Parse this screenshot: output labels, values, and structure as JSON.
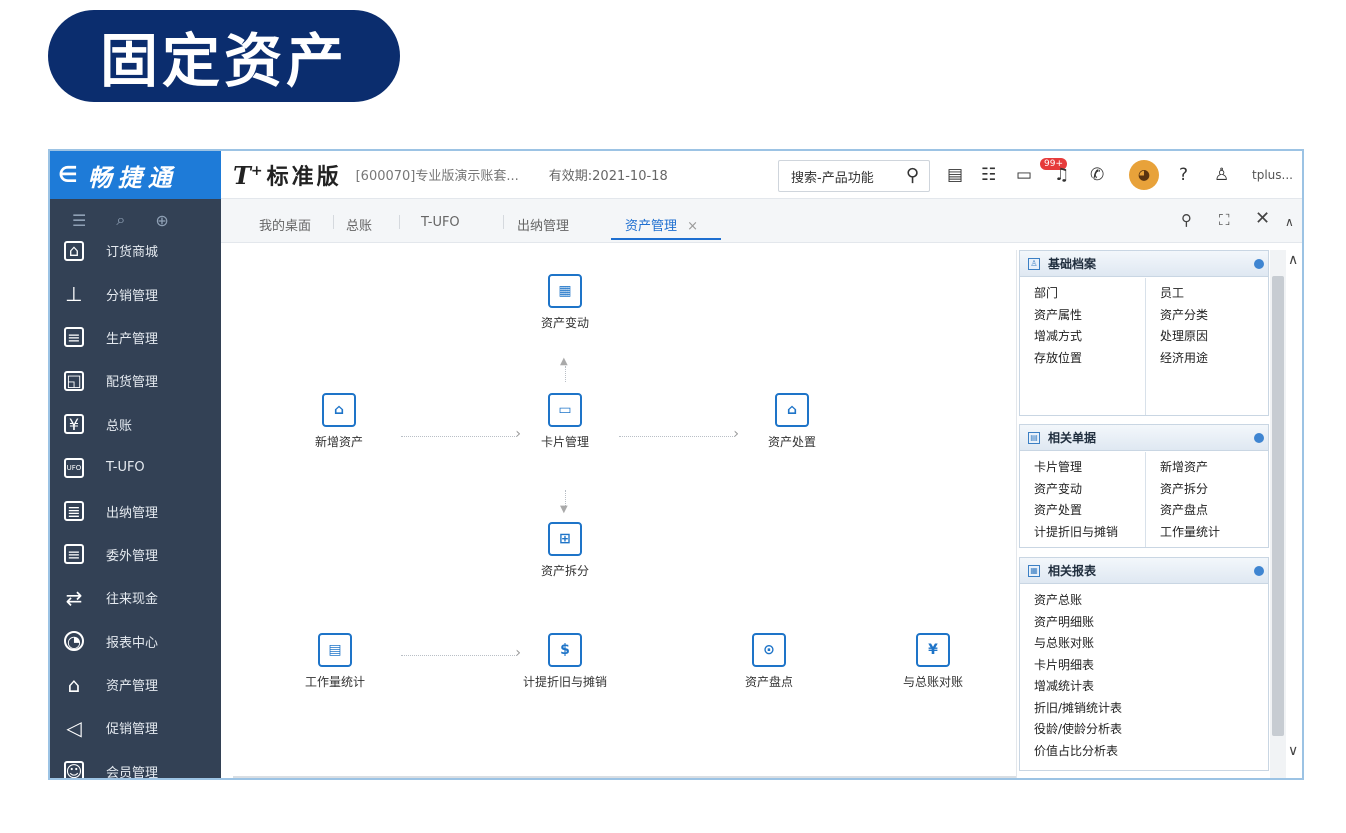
{
  "hero_title": "固定资产",
  "sidebar": {
    "logo": "畅捷通",
    "logo_arrow": "∈",
    "items": [
      {
        "label": "订货商城",
        "icon": "store-icon"
      },
      {
        "label": "分销管理",
        "icon": "org-chart-icon"
      },
      {
        "label": "生产管理",
        "icon": "production-icon"
      },
      {
        "label": "配货管理",
        "icon": "delivery-icon"
      },
      {
        "label": "总账",
        "icon": "ledger-icon"
      },
      {
        "label": "T-UFO",
        "icon": "ufo-icon"
      },
      {
        "label": "出纳管理",
        "icon": "cashier-icon"
      },
      {
        "label": "委外管理",
        "icon": "outsource-icon"
      },
      {
        "label": "往来现金",
        "icon": "exchange-icon"
      },
      {
        "label": "报表中心",
        "icon": "pie-chart-icon"
      },
      {
        "label": "资产管理",
        "icon": "bank-icon"
      },
      {
        "label": "促销管理",
        "icon": "megaphone-icon"
      },
      {
        "label": "会员管理",
        "icon": "member-icon"
      }
    ]
  },
  "topbar": {
    "brand": "T",
    "brand_sup": "+",
    "brand_cn": "标准版",
    "account": "[600070]专业版演示账套...",
    "expiry": "有效期:2021-10-18",
    "search_placeholder": "搜索-产品功能",
    "badge": "99+",
    "username": "tplus..."
  },
  "tabs": [
    "我的桌面",
    "总账",
    "T-UFO",
    "出纳管理",
    "资产管理"
  ],
  "active_tab_close": "×",
  "flow": {
    "asset_change": "资产变动",
    "new_asset": "新增资产",
    "card_management": "卡片管理",
    "asset_disposal": "资产处置",
    "asset_split": "资产拆分",
    "workload_stats": "工作量统计",
    "depreciation": "计提折旧与摊销",
    "asset_inventory": "资产盘点",
    "gl_reconcile": "与总账对账"
  },
  "panels": {
    "basic": {
      "title": "基础档案",
      "col1": [
        "部门",
        "资产属性",
        "增减方式",
        "存放位置"
      ],
      "col2": [
        "员工",
        "资产分类",
        "处理原因",
        "经济用途"
      ]
    },
    "documents": {
      "title": "相关单据",
      "col1": [
        "卡片管理",
        "资产变动",
        "资产处置",
        "计提折旧与摊销"
      ],
      "col2": [
        "新增资产",
        "资产拆分",
        "资产盘点",
        "工作量统计"
      ]
    },
    "reports": {
      "title": "相关报表",
      "col1": [
        "资产总账",
        "资产明细账",
        "与总账对账",
        "卡片明细表",
        "增减统计表",
        "折旧/摊销统计表",
        "役龄/使龄分析表",
        "价值占比分析表"
      ]
    }
  }
}
